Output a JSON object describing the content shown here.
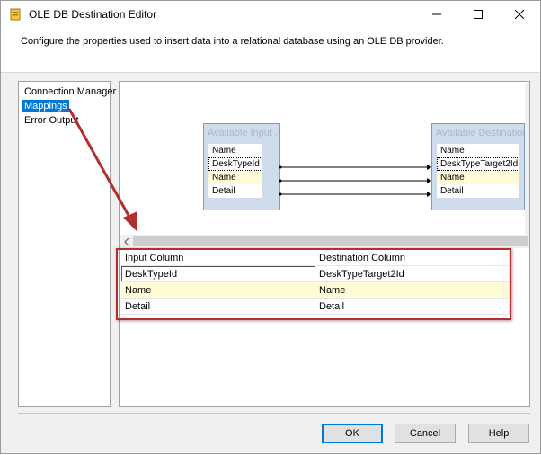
{
  "window": {
    "title": "OLE DB Destination Editor",
    "description": "Configure the properties used to insert data into a relational database using an OLE DB provider."
  },
  "nav": {
    "items": [
      {
        "label": "Connection Manager"
      },
      {
        "label": "Mappings"
      },
      {
        "label": "Error Output"
      }
    ],
    "selected": "Mappings"
  },
  "diagram": {
    "input_table": {
      "title": "Available Input ...",
      "columns": [
        "Name",
        "DeskTypeId",
        "Name",
        "Detail"
      ]
    },
    "destination_table": {
      "title": "Available Destination ...",
      "columns": [
        "Name",
        "DeskTypeTarget2Id",
        "Name",
        "Detail"
      ]
    }
  },
  "grid": {
    "headers": {
      "input": "Input Column",
      "destination": "Destination Column"
    },
    "rows": [
      {
        "input": "DeskTypeId",
        "destination": "DeskTypeTarget2Id"
      },
      {
        "input": "Name",
        "destination": "Name"
      },
      {
        "input": "Detail",
        "destination": "Detail"
      }
    ]
  },
  "buttons": {
    "ok": "OK",
    "cancel": "Cancel",
    "help": "Help"
  },
  "colors": {
    "accent": "#0078d7",
    "annotation": "#b03030",
    "highlight_row": "#fffbd6"
  }
}
